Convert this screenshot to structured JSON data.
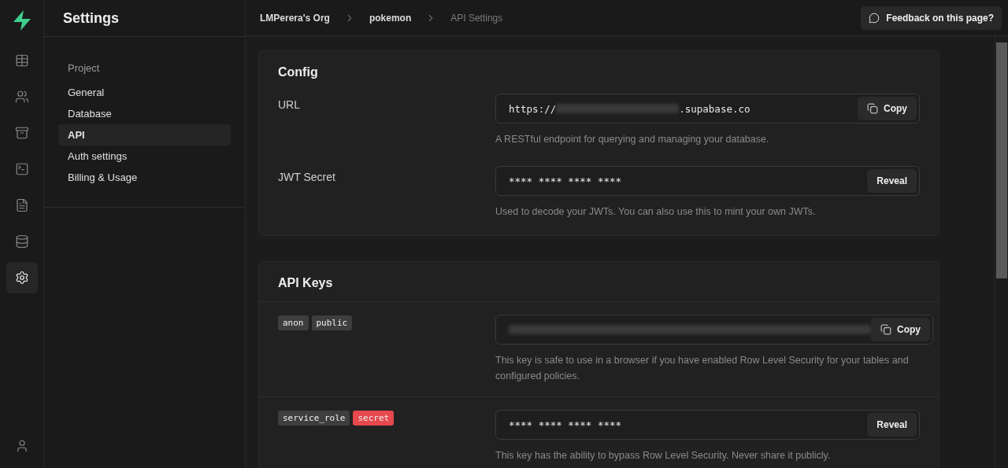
{
  "rail": {
    "items": [
      {
        "kind": "table",
        "selected": false
      },
      {
        "kind": "users",
        "selected": false
      },
      {
        "kind": "archive",
        "selected": false
      },
      {
        "kind": "terminal",
        "selected": false
      },
      {
        "kind": "document",
        "selected": false
      },
      {
        "kind": "database",
        "selected": false
      },
      {
        "kind": "settings",
        "selected": true
      }
    ]
  },
  "sidebar": {
    "title": "Settings",
    "section": "Project",
    "items": [
      {
        "label": "General",
        "selected": false
      },
      {
        "label": "Database",
        "selected": false
      },
      {
        "label": "API",
        "selected": true
      },
      {
        "label": "Auth settings",
        "selected": false
      },
      {
        "label": "Billing & Usage",
        "selected": false
      }
    ]
  },
  "breadcrumbs": [
    "LMPerera's Org",
    "pokemon",
    "API Settings"
  ],
  "feedback_button": "Feedback on this page?",
  "config": {
    "title": "Config",
    "rows": [
      {
        "kind": "url",
        "label": "URL",
        "prefix": "https://",
        "suffix": ".supabase.co",
        "button": "Copy",
        "help": "A RESTful endpoint for querying and managing your database."
      },
      {
        "kind": "secret",
        "label": "JWT Secret",
        "value": "**** **** **** ****",
        "button": "Reveal",
        "help": "Used to decode your JWTs. You can also use this to mint your own JWTs."
      }
    ]
  },
  "api_keys": {
    "title": "API Keys",
    "rows": [
      {
        "kind": "blurred",
        "tags": [
          {
            "text": "anon",
            "kind": "plain"
          },
          {
            "text": "public",
            "kind": "plain"
          }
        ],
        "button": "Copy",
        "help": "This key is safe to use in a browser if you have enabled Row Level Security for your tables and configured policies."
      },
      {
        "kind": "secret",
        "tags": [
          {
            "text": "service_role",
            "kind": "plain"
          },
          {
            "text": "secret",
            "kind": "danger"
          }
        ],
        "value": "**** **** **** ****",
        "button": "Reveal",
        "help": "This key has the ability to bypass Row Level Security. Never share it publicly."
      }
    ]
  }
}
